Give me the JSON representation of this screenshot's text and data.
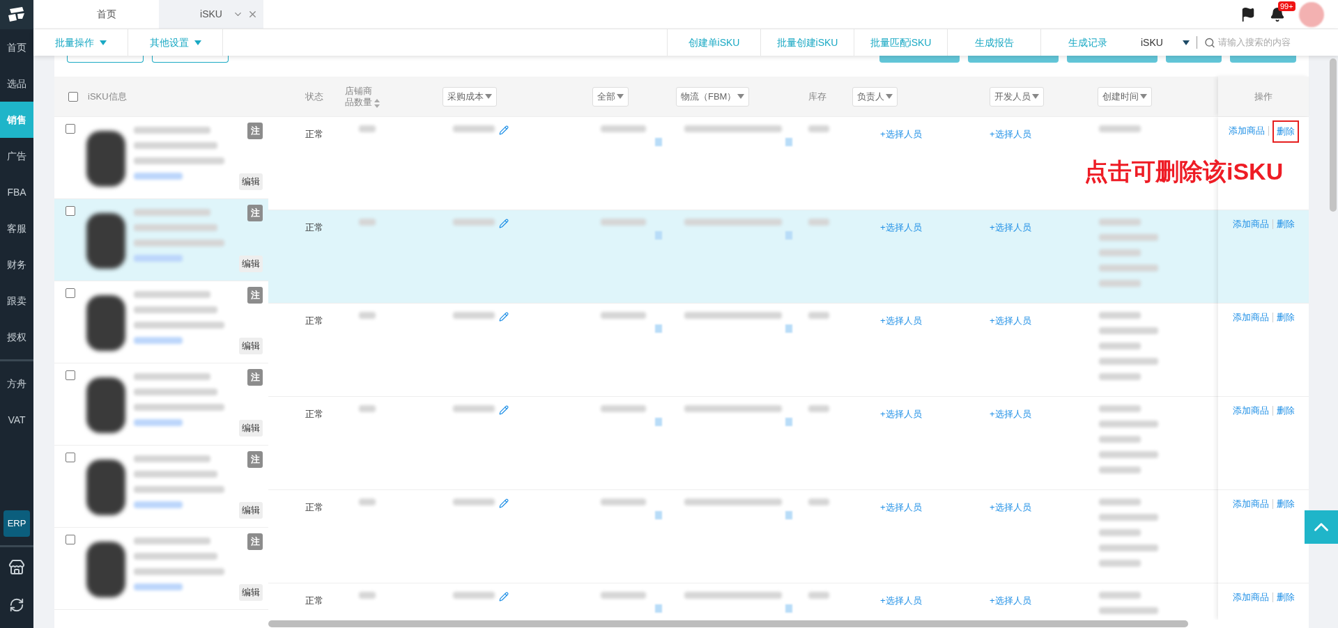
{
  "sidebar": {
    "items": [
      {
        "label": "首页",
        "selected": false
      },
      {
        "label": "选品",
        "selected": false
      },
      {
        "label": "销售",
        "selected": true
      },
      {
        "label": "广告",
        "selected": false
      },
      {
        "label": "FBA",
        "selected": false
      },
      {
        "label": "客服",
        "selected": false
      },
      {
        "label": "财务",
        "selected": false
      },
      {
        "label": "跟卖",
        "selected": false
      },
      {
        "label": "授权",
        "selected": false
      }
    ],
    "extra_items": [
      {
        "label": "方舟"
      },
      {
        "label": "VAT"
      }
    ],
    "erp_button": "ERP"
  },
  "tabs": [
    {
      "label": "首页",
      "selected": false,
      "closable": false
    },
    {
      "label": "iSKU",
      "selected": true,
      "closable": true
    }
  ],
  "notification_badge": "99+",
  "toolbar": {
    "menus": [
      "批量操作",
      "其他设置"
    ],
    "actions": [
      "创建单iSKU",
      "批量创建iSKU",
      "批量匹配iSKU",
      "生成报告",
      "生成记录"
    ],
    "search_scope": "iSKU",
    "search": {
      "placeholder": "请输入搜索的内容"
    }
  },
  "table": {
    "header_checked": false,
    "columns": [
      {
        "label": "iSKU信息",
        "kind": "plain"
      },
      {
        "label": "状态",
        "kind": "plain"
      },
      {
        "label": "店铺商品数量",
        "kind": "sortable"
      },
      {
        "label": "采购成本",
        "kind": "filter"
      },
      {
        "label": "全部",
        "kind": "filter"
      },
      {
        "label": "物流（FBM）",
        "kind": "filter"
      },
      {
        "label": "库存",
        "kind": "plain"
      },
      {
        "label": "负责人",
        "kind": "filter"
      },
      {
        "label": "开发人员",
        "kind": "filter"
      },
      {
        "label": "创建时间",
        "kind": "filter"
      },
      {
        "label": "操作",
        "kind": "plain"
      }
    ],
    "rows": [
      {
        "selected": false,
        "checked": false,
        "note": "注",
        "edit": "编辑",
        "status": "正常",
        "owner": "+选择人员",
        "developer": "+选择人员",
        "actions": [
          "添加商品",
          "删除"
        ],
        "annotation": "点击可删除该iSKU"
      },
      {
        "selected": true,
        "checked": false,
        "note": "注",
        "edit": "编辑",
        "status": "正常",
        "owner": "+选择人员",
        "developer": "+选择人员",
        "actions": [
          "添加商品",
          "删除"
        ]
      },
      {
        "selected": false,
        "checked": false,
        "note": "注",
        "edit": "编辑",
        "status": "正常",
        "owner": "+选择人员",
        "developer": "+选择人员",
        "actions": [
          "添加商品",
          "删除"
        ]
      },
      {
        "selected": false,
        "checked": false,
        "note": "注",
        "edit": "编辑",
        "status": "正常",
        "owner": "+选择人员",
        "developer": "+选择人员",
        "actions": [
          "添加商品",
          "删除"
        ]
      },
      {
        "selected": false,
        "checked": false,
        "note": "注",
        "edit": "编辑",
        "status": "正常",
        "owner": "+选择人员",
        "developer": "+选择人员",
        "actions": [
          "添加商品",
          "删除"
        ]
      },
      {
        "selected": false,
        "checked": false,
        "note": "注",
        "edit": "编辑",
        "status": "正常",
        "owner": "+选择人员",
        "developer": "+选择人员",
        "actions": [
          "添加商品",
          "删除"
        ]
      }
    ]
  }
}
